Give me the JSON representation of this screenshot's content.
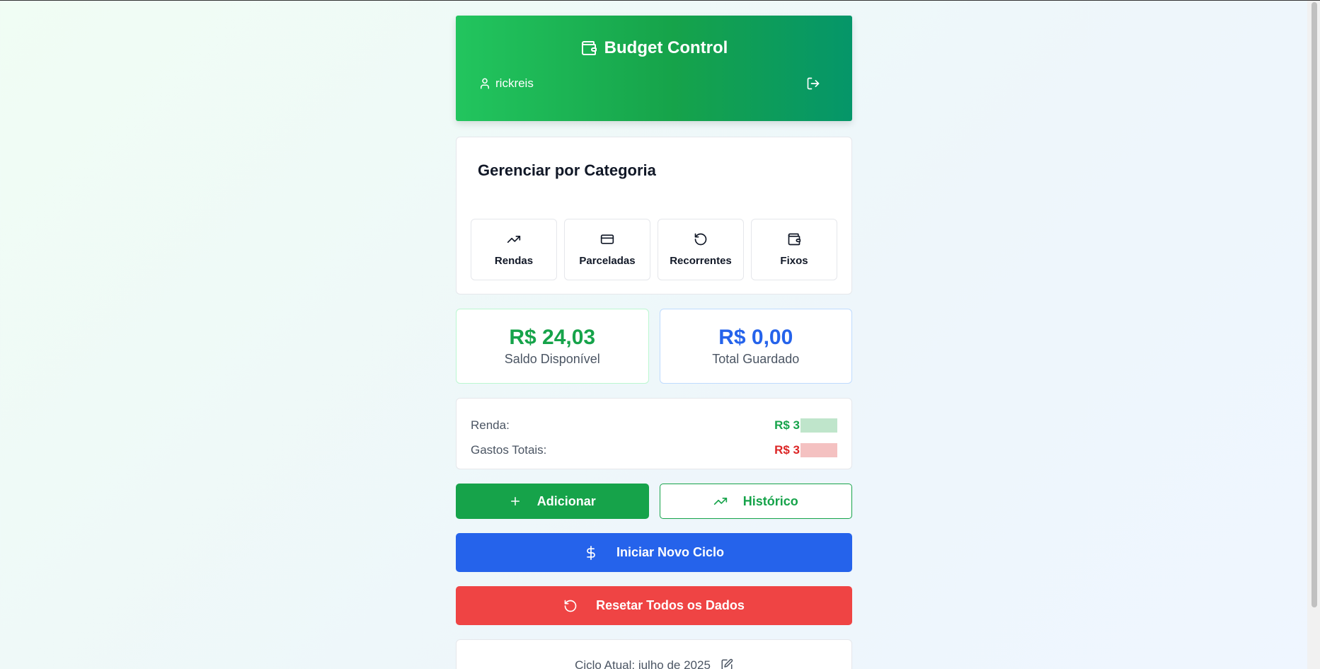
{
  "header": {
    "title": "Budget Control",
    "username": "rickreis"
  },
  "categories": {
    "title": "Gerenciar por Categoria",
    "items": [
      {
        "label": "Rendas",
        "icon": "trending-up-icon"
      },
      {
        "label": "Parceladas",
        "icon": "credit-card-icon"
      },
      {
        "label": "Recorrentes",
        "icon": "rotate-ccw-icon"
      },
      {
        "label": "Fixos",
        "icon": "wallet-icon"
      }
    ]
  },
  "stats": {
    "balance_value": "R$ 24,03",
    "balance_label": "Saldo Disponível",
    "saved_value": "R$ 0,00",
    "saved_label": "Total Guardado"
  },
  "summary": {
    "income_label": "Renda:",
    "income_value_visible": "R$ 3",
    "expenses_label": "Gastos Totais:",
    "expenses_value_visible": "R$ 3"
  },
  "actions": {
    "add_label": "Adicionar",
    "history_label": "Histórico",
    "new_cycle_label": "Iniciar Novo Ciclo",
    "reset_label": "Resetar Todos os Dados"
  },
  "footer": {
    "cycle_text": "Ciclo Atual: julho de 2025"
  },
  "colors": {
    "green": "#16a34a",
    "blue": "#2563eb",
    "red": "#ef4444"
  }
}
